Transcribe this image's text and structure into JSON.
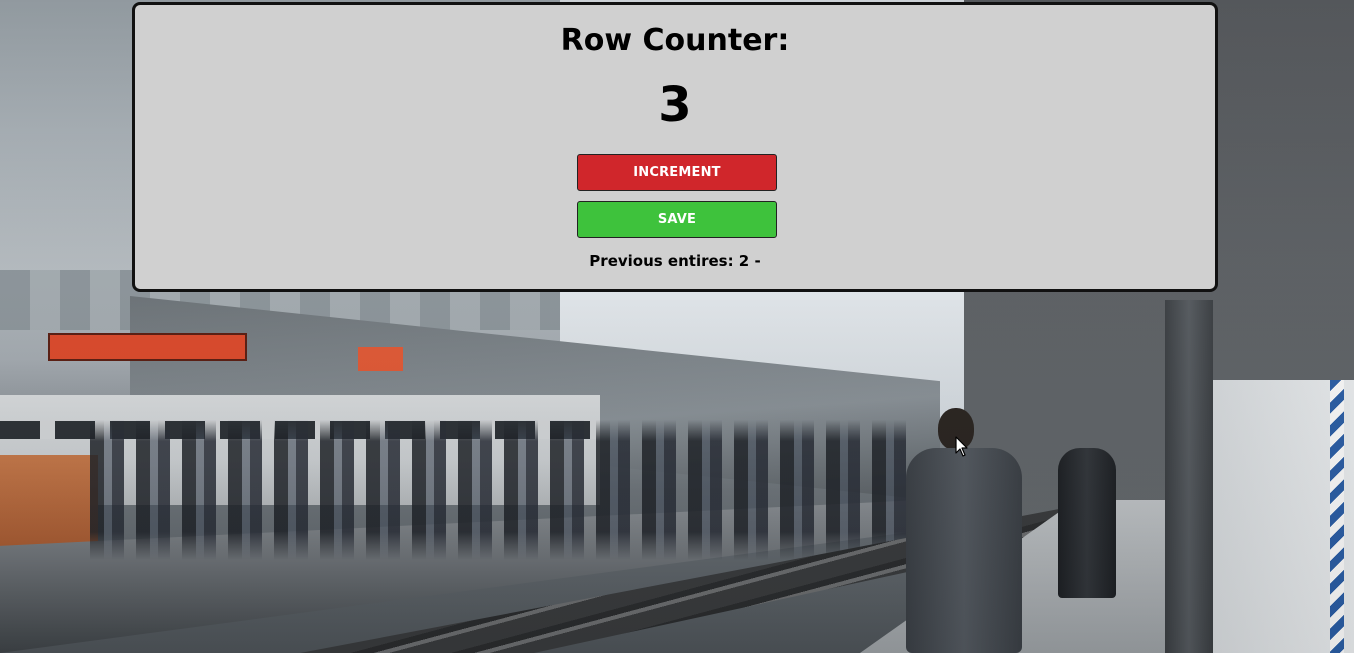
{
  "counter": {
    "title": "Row Counter:",
    "value": "3",
    "increment_label": "INCREMENT",
    "save_label": "SAVE",
    "previous_entries": "Previous entires: 2 -"
  },
  "colors": {
    "increment_button": "#d0262b",
    "save_button": "#3ec23c",
    "panel_background": "#d0d0d0",
    "panel_border": "#111111"
  },
  "background": {
    "icon": "train-station-photo"
  },
  "pointer": {
    "icon": "mouse-pointer-icon"
  }
}
